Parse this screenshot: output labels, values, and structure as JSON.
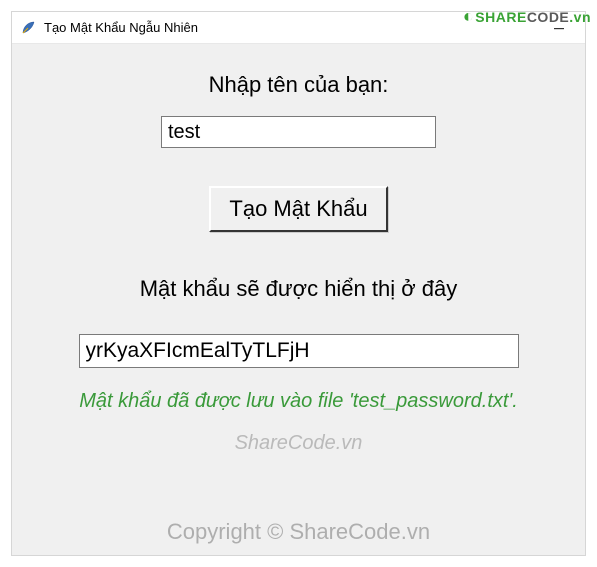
{
  "titlebar": {
    "title": "Tạo Mật Khẩu Ngẫu Nhiên"
  },
  "main": {
    "name_label": "Nhập tên của bạn:",
    "name_value": "test",
    "generate_button_label": "Tạo Mật Khẩu",
    "result_label": "Mật khẩu sẽ được hiển thị ở đây",
    "result_value": "yrKyaXFIcmEalTyTLFjH",
    "status_message": "Mật khẩu đã được lưu vào file 'test_password.txt'."
  },
  "watermark": {
    "line1": "ShareCode.vn",
    "line2": "Copyright © ShareCode.vn",
    "logo_part1": "SHARE",
    "logo_part2": "CODE",
    "logo_suffix": ".vn"
  }
}
